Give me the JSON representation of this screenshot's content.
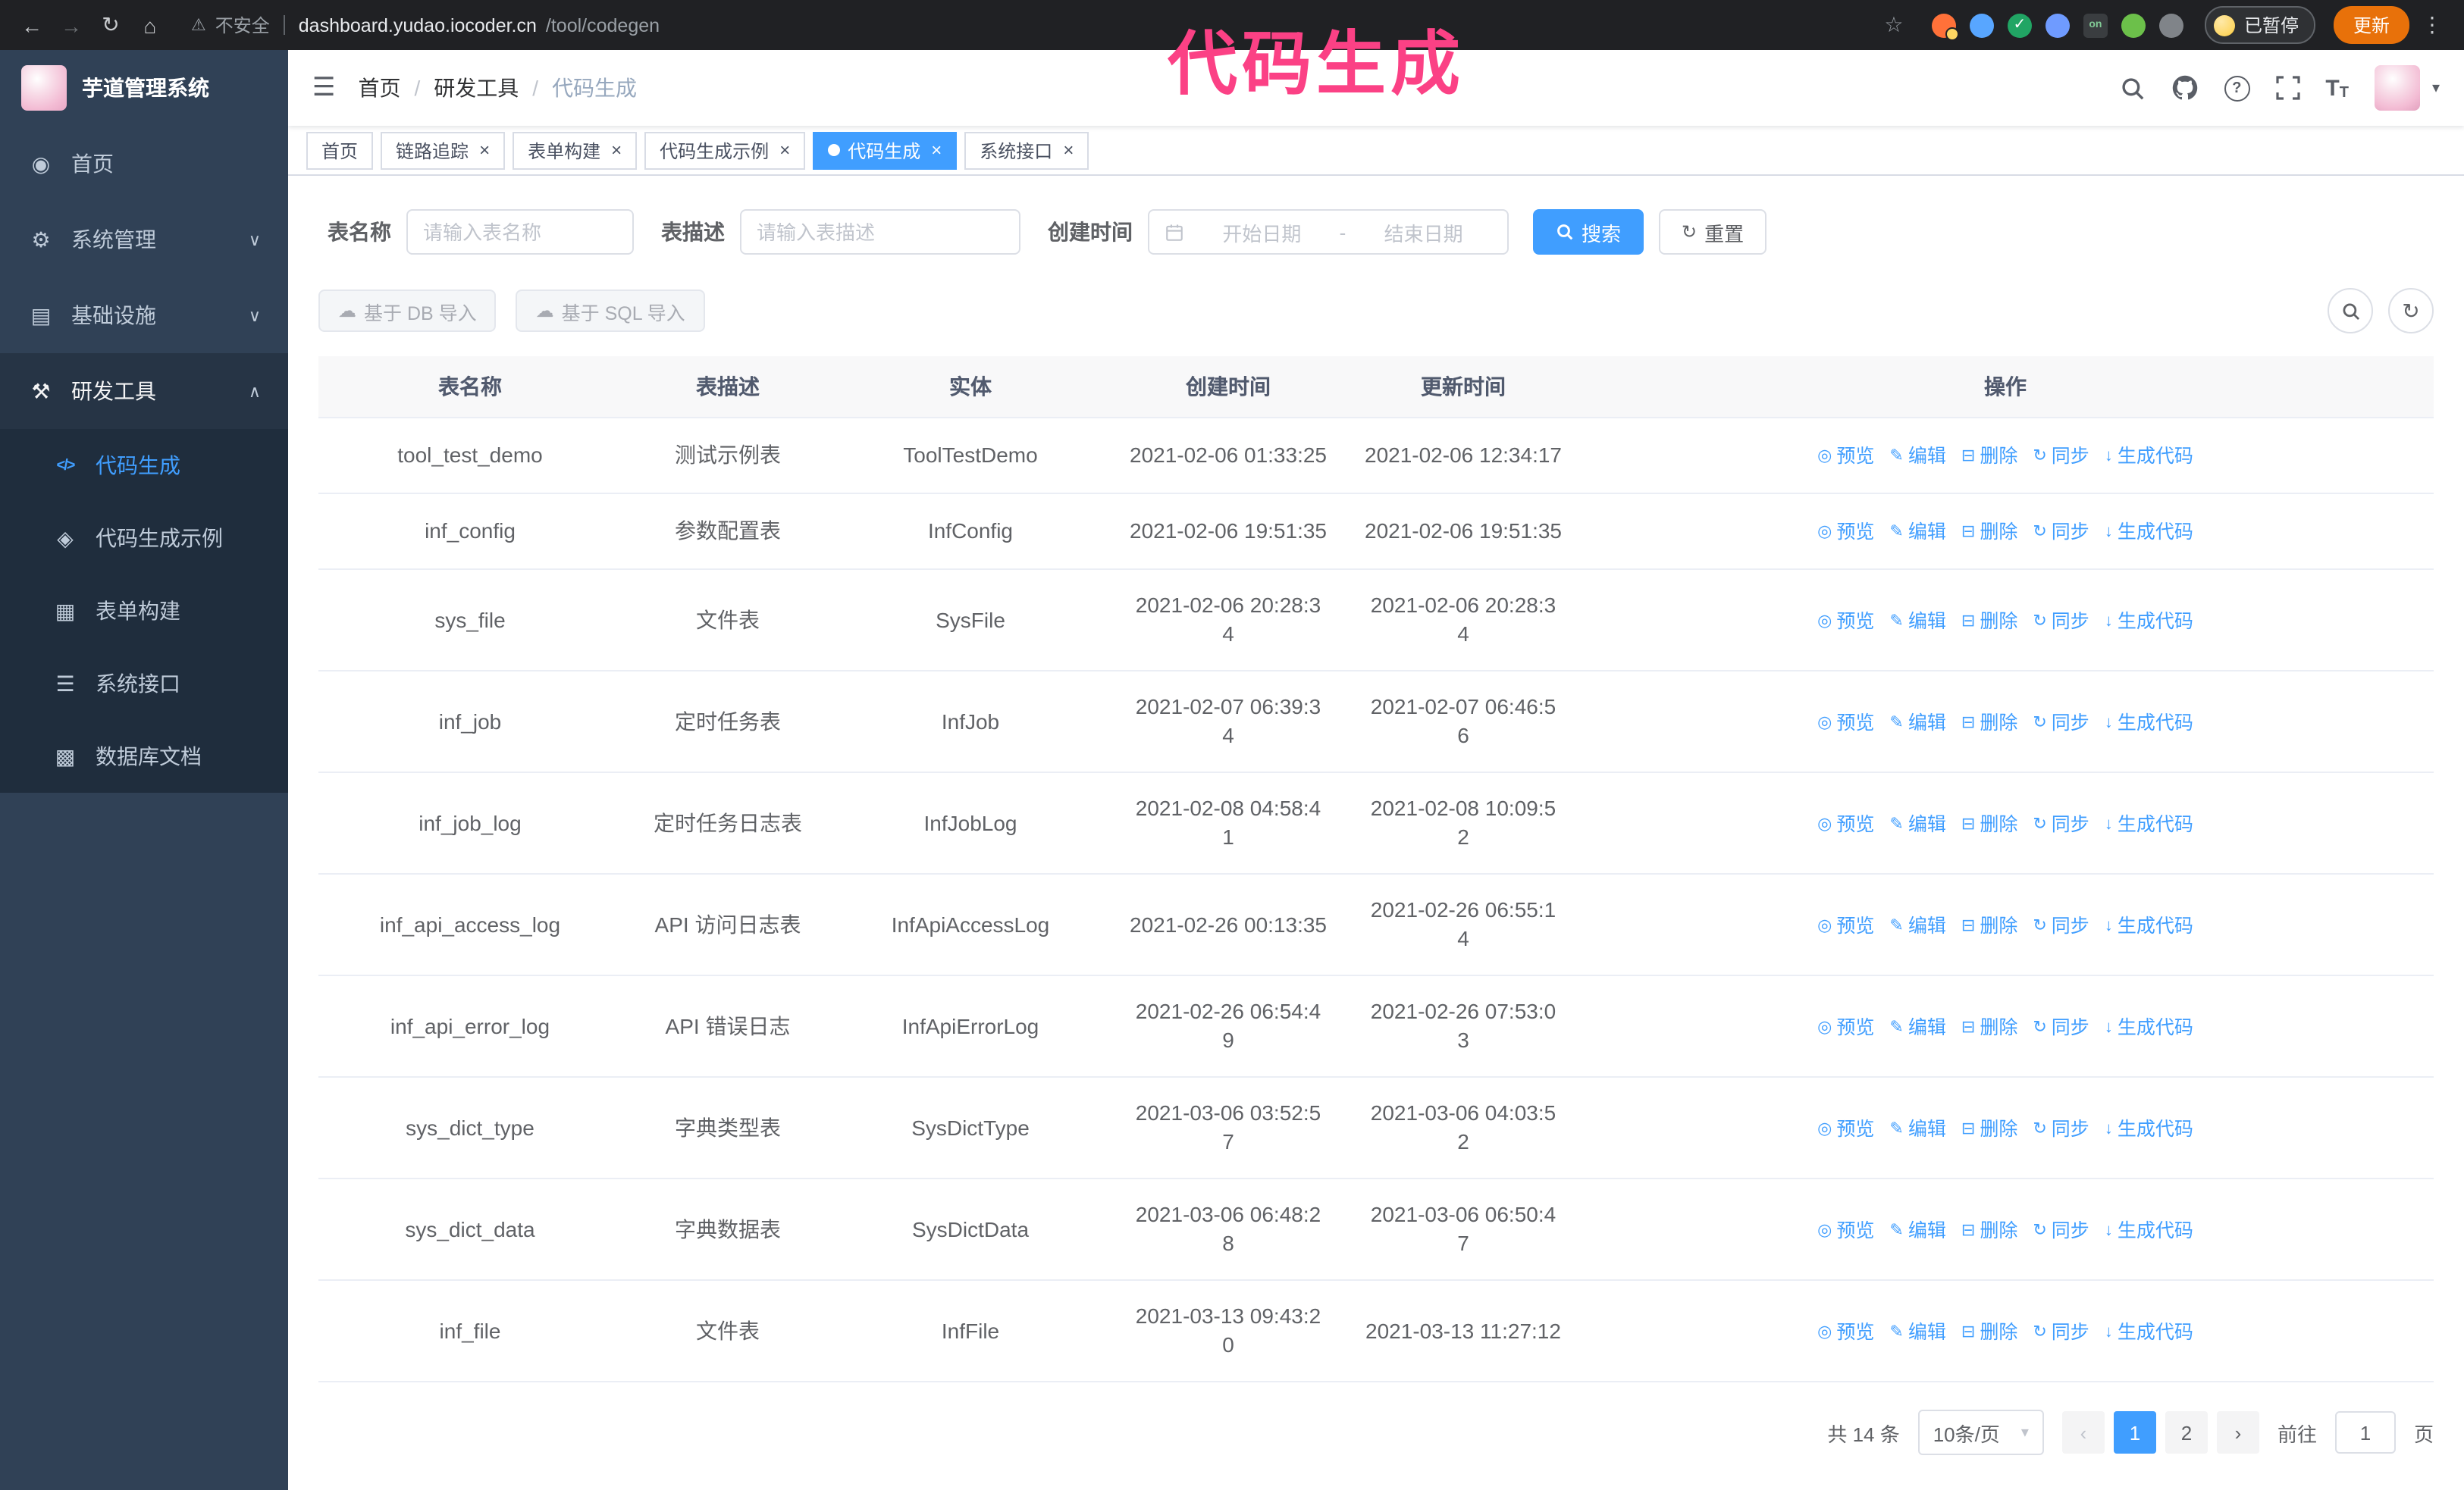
{
  "theme": {
    "accent": "#409eff",
    "sidebar_bg": "#304156",
    "submenu_bg": "#1f2d3d",
    "annotation_color": "#fb4185"
  },
  "annotation": {
    "text": "代码生成"
  },
  "browser": {
    "security_label": "不安全",
    "url_host": "dashboard.yudao.iocoder.cn",
    "url_path": "/tool/codegen",
    "profile_chip": "已暂停",
    "update_button": "更新",
    "extensions": [
      {
        "name": "ext-browser-logo",
        "color": "#ff7139",
        "badge_dot": true
      },
      {
        "name": "ext-water-drop",
        "color": "#58a6ff"
      },
      {
        "name": "ext-shield-check",
        "color": "#21a564",
        "check": true
      },
      {
        "name": "ext-contacts",
        "color": "#6f9bff"
      },
      {
        "name": "ext-switch-on",
        "color": "#3a3d40",
        "square": true,
        "badge_text": "on"
      },
      {
        "name": "ext-leaf",
        "color": "#6cc04a"
      },
      {
        "name": "ext-puzzle",
        "color": "#808489"
      }
    ]
  },
  "sidebar": {
    "logo_title": "芋道管理系统",
    "items": [
      {
        "key": "home",
        "label": "首页",
        "icon": "dashboard-icon"
      },
      {
        "key": "system",
        "label": "系统管理",
        "icon": "gear-icon",
        "chevron": "down"
      },
      {
        "key": "infra",
        "label": "基础设施",
        "icon": "infra-icon",
        "chevron": "down"
      },
      {
        "key": "devtools",
        "label": "研发工具",
        "icon": "tools-icon",
        "chevron": "up",
        "expanded": true
      }
    ],
    "submenu": [
      {
        "key": "codegen",
        "label": "代码生成",
        "icon": "code-icon",
        "active": true
      },
      {
        "key": "codegen-example",
        "label": "代码生成示例",
        "icon": "example-icon"
      },
      {
        "key": "form-builder",
        "label": "表单构建",
        "icon": "form-icon"
      },
      {
        "key": "system-api",
        "label": "系统接口",
        "icon": "api-icon"
      },
      {
        "key": "db-doc",
        "label": "数据库文档",
        "icon": "dbdoc-icon"
      }
    ]
  },
  "navbar": {
    "breadcrumb": [
      "首页",
      "研发工具",
      "代码生成"
    ],
    "breadcrumb_separator": "/"
  },
  "tabs": [
    {
      "key": "home",
      "label": "首页",
      "closable": false,
      "active": false
    },
    {
      "key": "tracing",
      "label": "链路追踪",
      "closable": true,
      "active": false
    },
    {
      "key": "form-builder",
      "label": "表单构建",
      "closable": true,
      "active": false
    },
    {
      "key": "codegen-example",
      "label": "代码生成示例",
      "closable": true,
      "active": false
    },
    {
      "key": "codegen",
      "label": "代码生成",
      "closable": true,
      "active": true
    },
    {
      "key": "system-api",
      "label": "系统接口",
      "closable": true,
      "active": false
    }
  ],
  "filters": {
    "table_name_label": "表名称",
    "table_name_placeholder": "请输入表名称",
    "table_desc_label": "表描述",
    "table_desc_placeholder": "请输入表描述",
    "create_time_label": "创建时间",
    "date_start_placeholder": "开始日期",
    "date_separator": "-",
    "date_end_placeholder": "结束日期",
    "search_button": "搜索",
    "reset_button": "重置"
  },
  "toolbar": {
    "import_db_button": "基于 DB 导入",
    "import_sql_button": "基于 SQL 导入"
  },
  "table": {
    "columns": [
      "表名称",
      "表描述",
      "实体",
      "创建时间",
      "更新时间",
      "操作"
    ],
    "actions": [
      {
        "key": "preview",
        "label": "预览",
        "icon": "preview-icon"
      },
      {
        "key": "edit",
        "label": "编辑",
        "icon": "edit-icon"
      },
      {
        "key": "delete",
        "label": "删除",
        "icon": "delete-icon"
      },
      {
        "key": "sync",
        "label": "同步",
        "icon": "sync-icon"
      },
      {
        "key": "generate",
        "label": "生成代码",
        "icon": "generate-icon"
      }
    ],
    "rows": [
      {
        "name": "tool_test_demo",
        "desc": "测试示例表",
        "entity": "ToolTestDemo",
        "created": "2021-02-06 01:33:25",
        "updated": "2021-02-06 12:34:17"
      },
      {
        "name": "inf_config",
        "desc": "参数配置表",
        "entity": "InfConfig",
        "created": "2021-02-06 19:51:35",
        "updated": "2021-02-06 19:51:35"
      },
      {
        "name": "sys_file",
        "desc": "文件表",
        "entity": "SysFile",
        "created": "2021-02-06 20:28:3\n4",
        "updated": "2021-02-06 20:28:3\n4"
      },
      {
        "name": "inf_job",
        "desc": "定时任务表",
        "entity": "InfJob",
        "created": "2021-02-07 06:39:3\n4",
        "updated": "2021-02-07 06:46:5\n6"
      },
      {
        "name": "inf_job_log",
        "desc": "定时任务日志表",
        "entity": "InfJobLog",
        "created": "2021-02-08 04:58:4\n1",
        "updated": "2021-02-08 10:09:5\n2"
      },
      {
        "name": "inf_api_access_log",
        "desc": "API 访问日志表",
        "entity": "InfApiAccessLog",
        "created": "2021-02-26 00:13:35",
        "updated": "2021-02-26 06:55:1\n4"
      },
      {
        "name": "inf_api_error_log",
        "desc": "API 错误日志",
        "entity": "InfApiErrorLog",
        "created": "2021-02-26 06:54:4\n9",
        "updated": "2021-02-26 07:53:0\n3"
      },
      {
        "name": "sys_dict_type",
        "desc": "字典类型表",
        "entity": "SysDictType",
        "created": "2021-03-06 03:52:5\n7",
        "updated": "2021-03-06 04:03:5\n2"
      },
      {
        "name": "sys_dict_data",
        "desc": "字典数据表",
        "entity": "SysDictData",
        "created": "2021-03-06 06:48:2\n8",
        "updated": "2021-03-06 06:50:4\n7"
      },
      {
        "name": "inf_file",
        "desc": "文件表",
        "entity": "InfFile",
        "created": "2021-03-13 09:43:2\n0",
        "updated": "2021-03-13 11:27:12"
      }
    ]
  },
  "pagination": {
    "total_label": "共 14 条",
    "page_size": "10条/页",
    "pages": [
      "1",
      "2"
    ],
    "active_page": "1",
    "prev_label": "‹",
    "next_label": "›",
    "goto_label": "前往",
    "goto_value": "1",
    "goto_suffix": "页"
  }
}
